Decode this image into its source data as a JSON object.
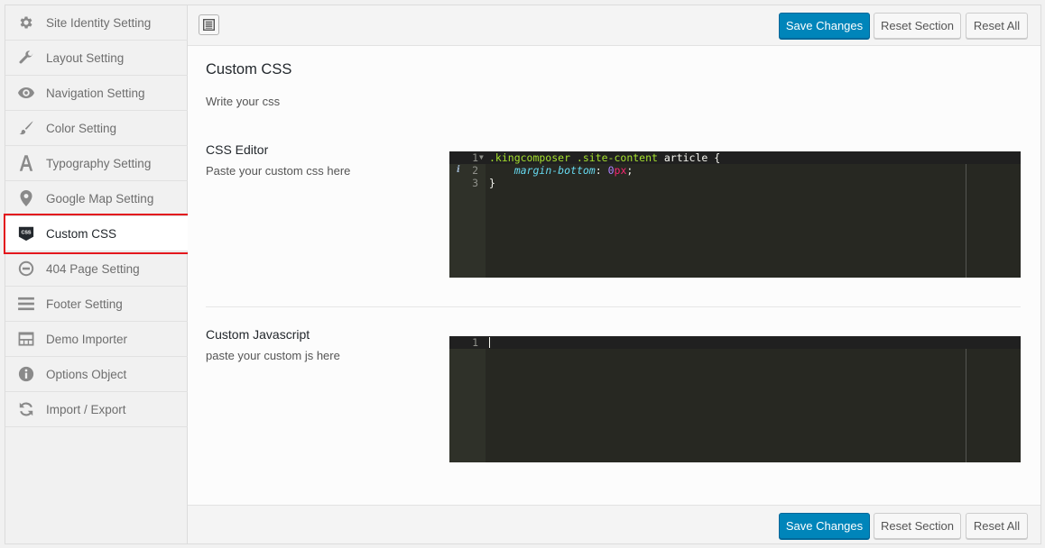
{
  "sidebar": {
    "items": [
      {
        "label": "Site Identity Setting",
        "icon": "gear-icon"
      },
      {
        "label": "Layout Setting",
        "icon": "wrench-icon"
      },
      {
        "label": "Navigation Setting",
        "icon": "eye-icon"
      },
      {
        "label": "Color Setting",
        "icon": "brush-icon"
      },
      {
        "label": "Typography Setting",
        "icon": "typography-icon"
      },
      {
        "label": "Google Map Setting",
        "icon": "map-pin-icon"
      },
      {
        "label": "Custom CSS",
        "icon": "css-icon",
        "icon_text": "CSS",
        "active": true
      },
      {
        "label": "404 Page Setting",
        "icon": "minus-circle-icon"
      },
      {
        "label": "Footer Setting",
        "icon": "menu-lines-icon"
      },
      {
        "label": "Demo Importer",
        "icon": "layout-icon"
      },
      {
        "label": "Options Object",
        "icon": "info-icon"
      },
      {
        "label": "Import / Export",
        "icon": "refresh-icon"
      }
    ]
  },
  "toolbar": {
    "save_label": "Save Changes",
    "reset_section_label": "Reset Section",
    "reset_all_label": "Reset All"
  },
  "section": {
    "title": "Custom CSS",
    "description": "Write your css"
  },
  "css_field": {
    "title": "CSS Editor",
    "description": "Paste your custom css here",
    "line_numbers": [
      "1",
      "2",
      "3"
    ],
    "code": {
      "line1_selector": ".kingcomposer .site-content",
      "line1_rest": " article {",
      "line2_indent": "    ",
      "line2_property": "margin-bottom",
      "line2_colon": ": ",
      "line2_number": "0",
      "line2_unit": "px",
      "line2_end": ";",
      "line3": "}"
    },
    "gutter_info_mark": "i"
  },
  "js_field": {
    "title": "Custom Javascript",
    "description": "paste your custom js here",
    "line_numbers": [
      "1"
    ]
  },
  "colors": {
    "primary_button": "#0085ba",
    "highlight_border": "#e3161d",
    "editor_background": "#272822"
  }
}
